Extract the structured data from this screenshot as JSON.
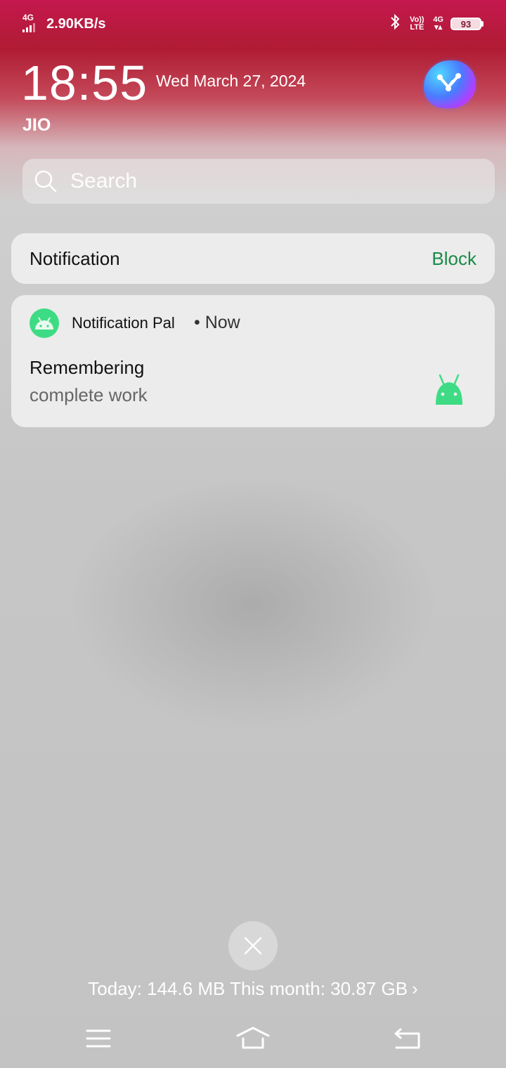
{
  "status_bar": {
    "network_type": "4G",
    "speed": "2.90KB/s",
    "volte": "Vo)) LTE",
    "data_type": "4G",
    "battery": "93",
    "icons": [
      "signal-icon",
      "bluetooth-icon",
      "volte-icon",
      "4g-data-icon",
      "battery-icon"
    ]
  },
  "header": {
    "time": "18:55",
    "date": "Wed March 27, 2024",
    "carrier": "JIO",
    "assistant_icon": "jovi-assistant-icon"
  },
  "search": {
    "placeholder": "Search",
    "icon": "search-icon"
  },
  "notification_header": {
    "title": "Notification",
    "action": "Block",
    "action_color": "#1a8a49"
  },
  "notification": {
    "app_name": "Notification Pal",
    "separator": "•",
    "time": "Now",
    "title": "Remembering",
    "text": "complete work",
    "app_icon": "android-icon",
    "accent": "#3ddc84"
  },
  "footer": {
    "clear_icon": "close-icon",
    "usage": "Today: 144.6 MB This month: 30.87 GB",
    "chevron": "›"
  },
  "nav_bar": {
    "icons": [
      "menu-icon",
      "home-icon",
      "back-icon"
    ]
  }
}
